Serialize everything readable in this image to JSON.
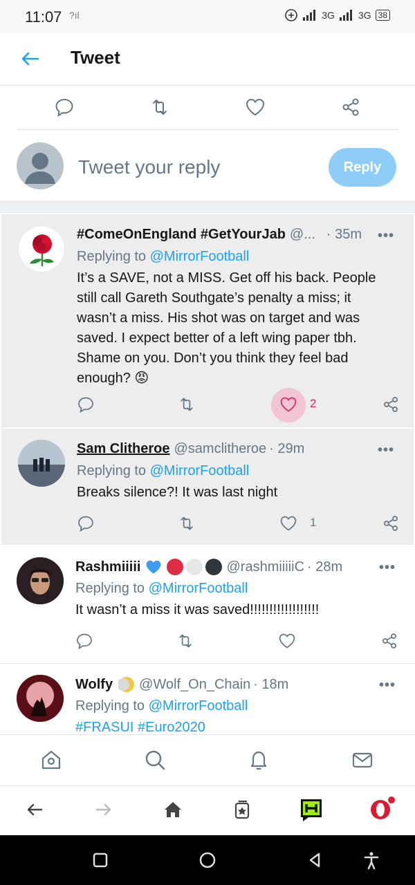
{
  "status_bar": {
    "time": "11:07",
    "left_signal": "?ıl",
    "network": "3G",
    "battery": "38"
  },
  "header": {
    "title": "Tweet"
  },
  "compose": {
    "placeholder": "Tweet your reply",
    "reply_label": "Reply"
  },
  "tweets": [
    {
      "name": "#ComeOnEngland #GetYourJab",
      "handle": "@...",
      "time": "· 35m",
      "replying_prefix": "Replying to",
      "mention": "@MirrorFootball",
      "text": "It’s a SAVE, not a MISS. Get off his back. People still call Gareth Southgate’s penalty a miss; it wasn’t a miss. His shot was on target and was saved. I expect better of a left wing paper tbh. Shame on you. Don’t you think they feel bad enough? 😡",
      "likes": "2",
      "liked": true
    },
    {
      "name": "Sam Clitheroe",
      "handle": "@samclitheroe",
      "time": "· 29m",
      "replying_prefix": "Replying to",
      "mention": "@MirrorFootball",
      "text": "Breaks silence?! It was last night",
      "likes": "1",
      "liked": false
    },
    {
      "name": "Rashmiiiii",
      "handle": "@rashmiiiiiC",
      "time": "· 28m",
      "replying_prefix": "Replying to",
      "mention": "@MirrorFootball",
      "text": "It wasn’t a miss it was saved!!!!!!!!!!!!!!!!!!",
      "likes": "",
      "liked": false
    },
    {
      "name": "Wolfy",
      "handle": "@Wolf_On_Chain",
      "time": "· 18m",
      "replying_prefix": "Replying to",
      "mention": "@MirrorFootball",
      "text": "#FRASUI #Euro2020",
      "likes": "",
      "liked": false
    }
  ],
  "more_label": "•••",
  "colors": {
    "accent": "#1da1f2",
    "like": "#e0245e",
    "reply_button": "#8ecdf7",
    "highlight_bg": "#ededed"
  },
  "icons": {
    "action_row": [
      "reply-icon",
      "retweet-icon",
      "like-icon",
      "share-icon"
    ],
    "tab_bar": [
      "home-icon",
      "search-icon",
      "notifications-icon",
      "messages-icon"
    ],
    "browser_bar": [
      "back-arrow-icon",
      "forward-arrow-icon",
      "browser-home-icon",
      "tabs-icon",
      "app-icon",
      "opera-icon"
    ],
    "system_nav": [
      "recents-icon",
      "home-circle-icon",
      "back-triangle-icon",
      "accessibility-icon"
    ]
  }
}
